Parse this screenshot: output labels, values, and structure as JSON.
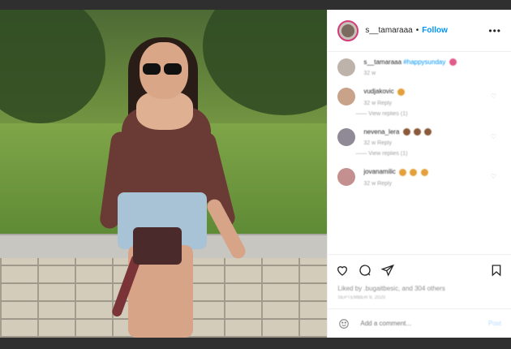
{
  "post": {
    "username": "s__tamaraaa",
    "separator": "•",
    "follow_label": "Follow",
    "more_label": "•••"
  },
  "comments": [
    {
      "name": "s__tamaraaa",
      "text": "#happysunday",
      "meta": "32 w",
      "replies": ""
    },
    {
      "name": "vudjakovic",
      "text": "",
      "meta": "32 w   Reply",
      "replies": "—— View replies (1)"
    },
    {
      "name": "nevena_lera",
      "text": "",
      "meta": "32 w   Reply",
      "replies": "—— View replies (1)"
    },
    {
      "name": "jovanamilic",
      "text": "",
      "meta": "32 w   Reply",
      "replies": ""
    }
  ],
  "likes_text": "Liked by .bugaitbesic, and 304 others",
  "date_text": "SEPTEMBER 9, 2020",
  "add_comment": {
    "placeholder": "Add a comment...",
    "post_label": "Post"
  }
}
